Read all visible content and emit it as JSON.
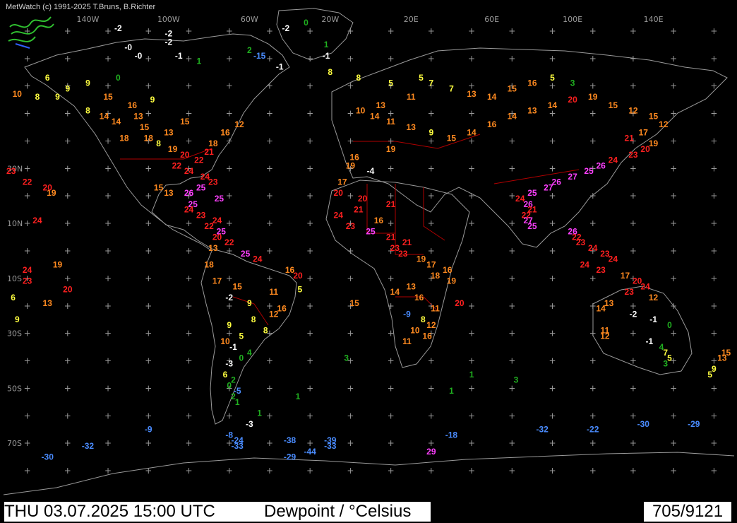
{
  "header": {
    "credit": "MetWatch  (c) 1991-2025 T.Bruns, B.Richter"
  },
  "footer": {
    "datetime": "THU 03.07.2025 15:00 UTC",
    "parameter": "Dewpoint / °Celsius",
    "count": "705/9121"
  },
  "map": {
    "projection": "equirectangular",
    "background": "#000000",
    "coastline_color": "#a0a0a0",
    "border_color": "#c00000",
    "grid_marker": "+"
  },
  "axis_labels": {
    "longitude": [
      "140W",
      "100W",
      "60W",
      "20W",
      "20E",
      "60E",
      "100E",
      "140E"
    ],
    "latitude": [
      "30N",
      "10N",
      "10S",
      "30S",
      "50S",
      "70S"
    ]
  },
  "legend_colors": {
    "below_0": "#4a8cff",
    "0_4": "#20b020",
    "5_9": "#ffff40",
    "10_19": "#ff8a20",
    "20_24": "#ff2020",
    "25_plus": "#ff40ff",
    "negative_cold": "#ffffff"
  },
  "observations": [
    {
      "lat": 80,
      "lon": -125,
      "v": "-2"
    },
    {
      "lat": 78,
      "lon": -100,
      "v": "-2"
    },
    {
      "lat": 80,
      "lon": -42,
      "v": "-2"
    },
    {
      "lat": 82,
      "lon": -32,
      "v": "0"
    },
    {
      "lat": 75,
      "lon": -100,
      "v": "-2"
    },
    {
      "lat": 73,
      "lon": -120,
      "v": "-0"
    },
    {
      "lat": 70,
      "lon": -115,
      "v": "-0"
    },
    {
      "lat": 70,
      "lon": -95,
      "v": "-1"
    },
    {
      "lat": 68,
      "lon": -85,
      "v": "1"
    },
    {
      "lat": 70,
      "lon": -55,
      "v": "-15"
    },
    {
      "lat": 72,
      "lon": -60,
      "v": "2"
    },
    {
      "lat": 66,
      "lon": -45,
      "v": "-1"
    },
    {
      "lat": 70,
      "lon": -22,
      "v": "-1"
    },
    {
      "lat": 74,
      "lon": -22,
      "v": "1"
    },
    {
      "lat": 62,
      "lon": -160,
      "v": "6"
    },
    {
      "lat": 58,
      "lon": -150,
      "v": "9"
    },
    {
      "lat": 60,
      "lon": -140,
      "v": "9"
    },
    {
      "lat": 62,
      "lon": -125,
      "v": "0"
    },
    {
      "lat": 56,
      "lon": -175,
      "v": "10"
    },
    {
      "lat": 55,
      "lon": -165,
      "v": "8"
    },
    {
      "lat": 55,
      "lon": -155,
      "v": "9"
    },
    {
      "lat": 55,
      "lon": -130,
      "v": "15"
    },
    {
      "lat": 52,
      "lon": -118,
      "v": "16"
    },
    {
      "lat": 54,
      "lon": -108,
      "v": "9"
    },
    {
      "lat": 50,
      "lon": -140,
      "v": "8"
    },
    {
      "lat": 48,
      "lon": -132,
      "v": "14"
    },
    {
      "lat": 46,
      "lon": -126,
      "v": "14"
    },
    {
      "lat": 48,
      "lon": -115,
      "v": "13"
    },
    {
      "lat": 44,
      "lon": -112,
      "v": "15"
    },
    {
      "lat": 42,
      "lon": -100,
      "v": "13"
    },
    {
      "lat": 46,
      "lon": -92,
      "v": "15"
    },
    {
      "lat": 40,
      "lon": -122,
      "v": "18"
    },
    {
      "lat": 40,
      "lon": -110,
      "v": "18"
    },
    {
      "lat": 38,
      "lon": -105,
      "v": "8"
    },
    {
      "lat": 36,
      "lon": -98,
      "v": "19"
    },
    {
      "lat": 34,
      "lon": -92,
      "v": "20"
    },
    {
      "lat": 32,
      "lon": -85,
      "v": "22"
    },
    {
      "lat": 35,
      "lon": -80,
      "v": "21"
    },
    {
      "lat": 38,
      "lon": -78,
      "v": "18"
    },
    {
      "lat": 42,
      "lon": -72,
      "v": "16"
    },
    {
      "lat": 45,
      "lon": -65,
      "v": "12"
    },
    {
      "lat": 30,
      "lon": -96,
      "v": "22"
    },
    {
      "lat": 28,
      "lon": -90,
      "v": "24"
    },
    {
      "lat": 26,
      "lon": -82,
      "v": "24"
    },
    {
      "lat": 24,
      "lon": -78,
      "v": "23"
    },
    {
      "lat": 22,
      "lon": -84,
      "v": "25"
    },
    {
      "lat": 20,
      "lon": -100,
      "v": "13"
    },
    {
      "lat": 22,
      "lon": -105,
      "v": "15"
    },
    {
      "lat": 20,
      "lon": -90,
      "v": "26"
    },
    {
      "lat": 18,
      "lon": -75,
      "v": "25"
    },
    {
      "lat": 16,
      "lon": -88,
      "v": "25"
    },
    {
      "lat": 14,
      "lon": -90,
      "v": "24"
    },
    {
      "lat": 12,
      "lon": -84,
      "v": "23"
    },
    {
      "lat": 10,
      "lon": -76,
      "v": "24"
    },
    {
      "lat": 8,
      "lon": -80,
      "v": "22"
    },
    {
      "lat": 6,
      "lon": -74,
      "v": "25"
    },
    {
      "lat": 4,
      "lon": -76,
      "v": "20"
    },
    {
      "lat": 2,
      "lon": -70,
      "v": "22"
    },
    {
      "lat": 0,
      "lon": -78,
      "v": "13"
    },
    {
      "lat": -2,
      "lon": -62,
      "v": "25"
    },
    {
      "lat": -4,
      "lon": -56,
      "v": "24"
    },
    {
      "lat": -6,
      "lon": -80,
      "v": "18"
    },
    {
      "lat": -8,
      "lon": -40,
      "v": "16"
    },
    {
      "lat": -10,
      "lon": -36,
      "v": "20"
    },
    {
      "lat": -12,
      "lon": -76,
      "v": "17"
    },
    {
      "lat": -14,
      "lon": -66,
      "v": "15"
    },
    {
      "lat": -16,
      "lon": -48,
      "v": "11"
    },
    {
      "lat": -18,
      "lon": -70,
      "v": "-2"
    },
    {
      "lat": -20,
      "lon": -60,
      "v": "9"
    },
    {
      "lat": -22,
      "lon": -44,
      "v": "16"
    },
    {
      "lat": -24,
      "lon": -48,
      "v": "12"
    },
    {
      "lat": -26,
      "lon": -58,
      "v": "8"
    },
    {
      "lat": -28,
      "lon": -70,
      "v": "9"
    },
    {
      "lat": -30,
      "lon": -52,
      "v": "8"
    },
    {
      "lat": -32,
      "lon": -64,
      "v": "5"
    },
    {
      "lat": -34,
      "lon": -72,
      "v": "10"
    },
    {
      "lat": -36,
      "lon": -68,
      "v": "-1"
    },
    {
      "lat": -38,
      "lon": -60,
      "v": "4"
    },
    {
      "lat": -40,
      "lon": -64,
      "v": "0"
    },
    {
      "lat": -42,
      "lon": -70,
      "v": "-3"
    },
    {
      "lat": -46,
      "lon": -72,
      "v": "6"
    },
    {
      "lat": -48,
      "lon": -68,
      "v": "2"
    },
    {
      "lat": -50,
      "lon": -70,
      "v": "0"
    },
    {
      "lat": -52,
      "lon": -66,
      "v": "-5"
    },
    {
      "lat": -54,
      "lon": -68,
      "v": "2"
    },
    {
      "lat": -56,
      "lon": -66,
      "v": "1"
    },
    {
      "lat": 62,
      "lon": -6,
      "v": "8"
    },
    {
      "lat": 64,
      "lon": -20,
      "v": "8"
    },
    {
      "lat": 60,
      "lon": 10,
      "v": "5"
    },
    {
      "lat": 62,
      "lon": 25,
      "v": "5"
    },
    {
      "lat": 60,
      "lon": 30,
      "v": "7"
    },
    {
      "lat": 58,
      "lon": 40,
      "v": "7"
    },
    {
      "lat": 56,
      "lon": 50,
      "v": "13"
    },
    {
      "lat": 55,
      "lon": 60,
      "v": "14"
    },
    {
      "lat": 58,
      "lon": 70,
      "v": "15"
    },
    {
      "lat": 60,
      "lon": 80,
      "v": "16"
    },
    {
      "lat": 62,
      "lon": 90,
      "v": "5"
    },
    {
      "lat": 60,
      "lon": 100,
      "v": "3"
    },
    {
      "lat": 55,
      "lon": 20,
      "v": "11"
    },
    {
      "lat": 52,
      "lon": 5,
      "v": "13"
    },
    {
      "lat": 50,
      "lon": -5,
      "v": "10"
    },
    {
      "lat": 48,
      "lon": 2,
      "v": "14"
    },
    {
      "lat": 46,
      "lon": 10,
      "v": "11"
    },
    {
      "lat": 44,
      "lon": 20,
      "v": "13"
    },
    {
      "lat": 42,
      "lon": 30,
      "v": "9"
    },
    {
      "lat": 40,
      "lon": 40,
      "v": "15"
    },
    {
      "lat": 42,
      "lon": 50,
      "v": "14"
    },
    {
      "lat": 45,
      "lon": 60,
      "v": "16"
    },
    {
      "lat": 48,
      "lon": 70,
      "v": "14"
    },
    {
      "lat": 50,
      "lon": 80,
      "v": "13"
    },
    {
      "lat": 52,
      "lon": 90,
      "v": "14"
    },
    {
      "lat": 54,
      "lon": 100,
      "v": "20"
    },
    {
      "lat": 55,
      "lon": 110,
      "v": "19"
    },
    {
      "lat": 52,
      "lon": 120,
      "v": "15"
    },
    {
      "lat": 50,
      "lon": 130,
      "v": "12"
    },
    {
      "lat": 48,
      "lon": 140,
      "v": "15"
    },
    {
      "lat": 45,
      "lon": 145,
      "v": "12"
    },
    {
      "lat": 42,
      "lon": 135,
      "v": "17"
    },
    {
      "lat": 40,
      "lon": 128,
      "v": "21"
    },
    {
      "lat": 38,
      "lon": 140,
      "v": "19"
    },
    {
      "lat": 36,
      "lon": 136,
      "v": "20"
    },
    {
      "lat": 34,
      "lon": 130,
      "v": "23"
    },
    {
      "lat": 32,
      "lon": 120,
      "v": "24"
    },
    {
      "lat": 30,
      "lon": 114,
      "v": "26"
    },
    {
      "lat": 28,
      "lon": 108,
      "v": "25"
    },
    {
      "lat": 26,
      "lon": 100,
      "v": "27"
    },
    {
      "lat": 24,
      "lon": 92,
      "v": "26"
    },
    {
      "lat": 22,
      "lon": 88,
      "v": "27"
    },
    {
      "lat": 20,
      "lon": 80,
      "v": "25"
    },
    {
      "lat": 18,
      "lon": 74,
      "v": "24"
    },
    {
      "lat": 16,
      "lon": 78,
      "v": "26"
    },
    {
      "lat": 14,
      "lon": 80,
      "v": "21"
    },
    {
      "lat": 12,
      "lon": 77,
      "v": "22"
    },
    {
      "lat": 10,
      "lon": 78,
      "v": "27"
    },
    {
      "lat": 8,
      "lon": 80,
      "v": "25"
    },
    {
      "lat": 6,
      "lon": 100,
      "v": "26"
    },
    {
      "lat": 4,
      "lon": 102,
      "v": "22"
    },
    {
      "lat": 2,
      "lon": 104,
      "v": "23"
    },
    {
      "lat": 0,
      "lon": 110,
      "v": "24"
    },
    {
      "lat": -2,
      "lon": 116,
      "v": "23"
    },
    {
      "lat": -4,
      "lon": 120,
      "v": "24"
    },
    {
      "lat": -6,
      "lon": 106,
      "v": "24"
    },
    {
      "lat": -8,
      "lon": 114,
      "v": "23"
    },
    {
      "lat": -10,
      "lon": 126,
      "v": "17"
    },
    {
      "lat": -12,
      "lon": 132,
      "v": "20"
    },
    {
      "lat": -14,
      "lon": 136,
      "v": "24"
    },
    {
      "lat": -16,
      "lon": 128,
      "v": "23"
    },
    {
      "lat": -18,
      "lon": 140,
      "v": "12"
    },
    {
      "lat": -20,
      "lon": 118,
      "v": "13"
    },
    {
      "lat": -22,
      "lon": 114,
      "v": "14"
    },
    {
      "lat": -24,
      "lon": 130,
      "v": "-2"
    },
    {
      "lat": -26,
      "lon": 140,
      "v": "-1"
    },
    {
      "lat": -28,
      "lon": 148,
      "v": "0"
    },
    {
      "lat": -30,
      "lon": 116,
      "v": "11"
    },
    {
      "lat": -32,
      "lon": 116,
      "v": "12"
    },
    {
      "lat": -34,
      "lon": 138,
      "v": "-1"
    },
    {
      "lat": -36,
      "lon": 144,
      "v": "4"
    },
    {
      "lat": -38,
      "lon": 146,
      "v": "7"
    },
    {
      "lat": -40,
      "lon": 148,
      "v": "5"
    },
    {
      "lat": -42,
      "lon": 146,
      "v": "3"
    },
    {
      "lat": -44,
      "lon": 170,
      "v": "9"
    },
    {
      "lat": -46,
      "lon": 168,
      "v": "5"
    },
    {
      "lat": -38,
      "lon": 176,
      "v": "15"
    },
    {
      "lat": -40,
      "lon": 174,
      "v": "13"
    },
    {
      "lat": 36,
      "lon": 10,
      "v": "19"
    },
    {
      "lat": 33,
      "lon": -8,
      "v": "16"
    },
    {
      "lat": 30,
      "lon": -10,
      "v": "19"
    },
    {
      "lat": 28,
      "lon": 0,
      "v": "-4"
    },
    {
      "lat": 24,
      "lon": -14,
      "v": "17"
    },
    {
      "lat": 20,
      "lon": -16,
      "v": "20"
    },
    {
      "lat": 18,
      "lon": -4,
      "v": "20"
    },
    {
      "lat": 16,
      "lon": 10,
      "v": "21"
    },
    {
      "lat": 14,
      "lon": -6,
      "v": "21"
    },
    {
      "lat": 12,
      "lon": -16,
      "v": "24"
    },
    {
      "lat": 10,
      "lon": 4,
      "v": "16"
    },
    {
      "lat": 8,
      "lon": -10,
      "v": "23"
    },
    {
      "lat": 6,
      "lon": 0,
      "v": "25"
    },
    {
      "lat": 4,
      "lon": 10,
      "v": "21"
    },
    {
      "lat": 2,
      "lon": 18,
      "v": "21"
    },
    {
      "lat": 0,
      "lon": 12,
      "v": "23"
    },
    {
      "lat": -2,
      "lon": 16,
      "v": "23"
    },
    {
      "lat": -4,
      "lon": 25,
      "v": "19"
    },
    {
      "lat": -6,
      "lon": 30,
      "v": "17"
    },
    {
      "lat": -8,
      "lon": 38,
      "v": "16"
    },
    {
      "lat": -10,
      "lon": 32,
      "v": "18"
    },
    {
      "lat": -12,
      "lon": 40,
      "v": "19"
    },
    {
      "lat": -14,
      "lon": 20,
      "v": "13"
    },
    {
      "lat": -16,
      "lon": 12,
      "v": "14"
    },
    {
      "lat": -18,
      "lon": 24,
      "v": "16"
    },
    {
      "lat": -20,
      "lon": 44,
      "v": "20"
    },
    {
      "lat": -22,
      "lon": 32,
      "v": "11"
    },
    {
      "lat": -24,
      "lon": 18,
      "v": "-9"
    },
    {
      "lat": -26,
      "lon": 26,
      "v": "8"
    },
    {
      "lat": -28,
      "lon": 30,
      "v": "12"
    },
    {
      "lat": -30,
      "lon": 22,
      "v": "10"
    },
    {
      "lat": -32,
      "lon": 28,
      "v": "16"
    },
    {
      "lat": -34,
      "lon": 18,
      "v": "11"
    },
    {
      "lat": -20,
      "lon": -8,
      "v": "15"
    },
    {
      "lat": -15,
      "lon": -35,
      "v": "5"
    },
    {
      "lat": -46,
      "lon": 50,
      "v": "1"
    },
    {
      "lat": -48,
      "lon": 72,
      "v": "3"
    },
    {
      "lat": -40,
      "lon": -12,
      "v": "3"
    },
    {
      "lat": -26,
      "lon": -175,
      "v": "9"
    },
    {
      "lat": -18,
      "lon": -177,
      "v": "6"
    },
    {
      "lat": -20,
      "lon": -160,
      "v": "13"
    },
    {
      "lat": -15,
      "lon": -150,
      "v": "20"
    },
    {
      "lat": -12,
      "lon": -170,
      "v": "23"
    },
    {
      "lat": -8,
      "lon": -170,
      "v": "24"
    },
    {
      "lat": -6,
      "lon": -155,
      "v": "19"
    },
    {
      "lat": 10,
      "lon": -165,
      "v": "24"
    },
    {
      "lat": 20,
      "lon": -158,
      "v": "19"
    },
    {
      "lat": 22,
      "lon": -160,
      "v": "20"
    },
    {
      "lat": 28,
      "lon": -178,
      "v": "23"
    },
    {
      "lat": 24,
      "lon": -170,
      "v": "22"
    },
    {
      "lat": -64,
      "lon": -60,
      "v": "-3"
    },
    {
      "lat": -66,
      "lon": -110,
      "v": "-9"
    },
    {
      "lat": -68,
      "lon": -70,
      "v": "-8"
    },
    {
      "lat": -70,
      "lon": -66,
      "v": "-24"
    },
    {
      "lat": -72,
      "lon": -66,
      "v": "-33"
    },
    {
      "lat": -70,
      "lon": -40,
      "v": "-38"
    },
    {
      "lat": -70,
      "lon": -20,
      "v": "-39"
    },
    {
      "lat": -72,
      "lon": -20,
      "v": "-33"
    },
    {
      "lat": -74,
      "lon": -30,
      "v": "-44"
    },
    {
      "lat": -76,
      "lon": -40,
      "v": "-29"
    },
    {
      "lat": -68,
      "lon": 40,
      "v": "-18"
    },
    {
      "lat": -66,
      "lon": 85,
      "v": "-32"
    },
    {
      "lat": -66,
      "lon": 110,
      "v": "-22"
    },
    {
      "lat": -64,
      "lon": 135,
      "v": "-30"
    },
    {
      "lat": -64,
      "lon": 160,
      "v": "-29"
    },
    {
      "lat": -72,
      "lon": -140,
      "v": "-32"
    },
    {
      "lat": -76,
      "lon": -160,
      "v": "-30"
    },
    {
      "lat": -74,
      "lon": 30,
      "v": "29"
    },
    {
      "lat": -60,
      "lon": -55,
      "v": "1"
    },
    {
      "lat": -54,
      "lon": -36,
      "v": "1"
    },
    {
      "lat": -52,
      "lon": 40,
      "v": "1"
    }
  ]
}
